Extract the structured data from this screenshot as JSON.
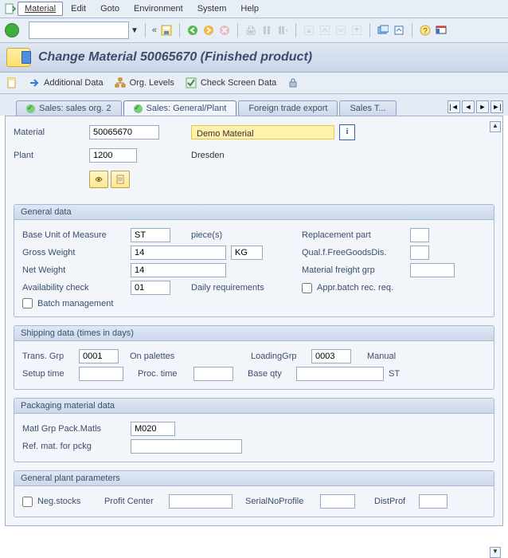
{
  "menu": {
    "items": [
      "Material",
      "Edit",
      "Goto",
      "Environment",
      "System",
      "Help"
    ],
    "active_index": 0
  },
  "title": "Change Material 50065670 (Finished product)",
  "pagetoolbar": {
    "additional_data": "Additional Data",
    "org_levels": "Org. Levels",
    "check_screen": "Check Screen Data"
  },
  "tabs": {
    "t0": "Sales: sales org. 2",
    "t1": "Sales: General/Plant",
    "t2": "Foreign trade export",
    "t3": "Sales T..."
  },
  "header": {
    "material_lbl": "Material",
    "material_val": "50065670",
    "material_desc": "Demo Material",
    "plant_lbl": "Plant",
    "plant_val": "1200",
    "plant_desc": "Dresden"
  },
  "general": {
    "title": "General data",
    "uom_lbl": "Base Unit of Measure",
    "uom_val": "ST",
    "uom_txt": "piece(s)",
    "repl_lbl": "Replacement part",
    "repl_val": "",
    "gross_lbl": "Gross Weight",
    "gross_val": "14",
    "gross_unit": "KG",
    "qual_lbl": "Qual.f.FreeGoodsDis.",
    "qual_val": "",
    "net_lbl": "Net Weight",
    "net_val": "14",
    "freight_lbl": "Material freight grp",
    "freight_val": "",
    "avail_lbl": "Availability check",
    "avail_val": "01",
    "avail_txt": "Daily requirements",
    "appr_lbl": "Appr.batch rec. req.",
    "batch_lbl": "Batch management"
  },
  "shipping": {
    "title": "Shipping data (times in days)",
    "trans_lbl": "Trans. Grp",
    "trans_val": "0001",
    "trans_txt": "On palettes",
    "load_lbl": "LoadingGrp",
    "load_val": "0003",
    "load_txt": "Manual",
    "setup_lbl": "Setup time",
    "setup_val": "",
    "proc_lbl": "Proc. time",
    "proc_val": "",
    "base_lbl": "Base qty",
    "base_val": "",
    "base_unit": "ST"
  },
  "packaging": {
    "title": "Packaging material data",
    "matlgrp_lbl": "Matl Grp Pack.Matls",
    "matlgrp_val": "M020",
    "refmat_lbl": "Ref. mat. for pckg",
    "refmat_val": ""
  },
  "plantparams": {
    "title": "General plant parameters",
    "neg_lbl": "Neg.stocks",
    "profit_lbl": "Profit Center",
    "profit_val": "",
    "serial_lbl": "SerialNoProfile",
    "serial_val": "",
    "dist_lbl": "DistProf",
    "dist_val": ""
  }
}
